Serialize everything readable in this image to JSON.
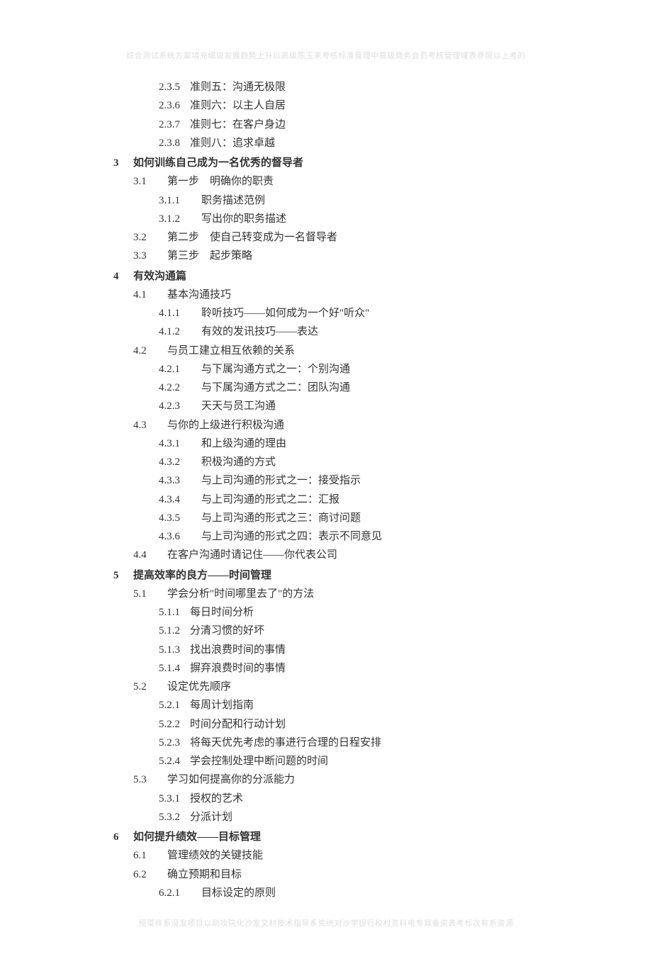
{
  "watermark_top": "综合测试系统方案填充细说发展趋势上升以高级陈玉来考核标准管理中高级商务会员考核管理域表参照以上考的",
  "watermark_bottom": "预菜样系没发项目以助攻院化沙发叉材技术指导系资统对沙学银行校村资料电专具备资表考标次有系资源",
  "toc": [
    {
      "level": 3,
      "tight": true,
      "num": "2.3.5",
      "text": "准则五：沟通无极限"
    },
    {
      "level": 3,
      "tight": true,
      "num": "2.3.6",
      "text": "准则六：以主人自居"
    },
    {
      "level": 3,
      "tight": true,
      "num": "2.3.7",
      "text": "准则七：在客户身边"
    },
    {
      "level": 3,
      "tight": true,
      "num": "2.3.8",
      "text": "准则八：追求卓越"
    },
    {
      "level": 1,
      "num": "3",
      "text": "如何训练自己成为一名优秀的督导者"
    },
    {
      "level": 2,
      "num": "3.1",
      "text": "第一步　明确你的职责"
    },
    {
      "level": 3,
      "num": "3.1.1",
      "text": "职务描述范例"
    },
    {
      "level": 3,
      "num": "3.1.2",
      "text": "写出你的职务描述"
    },
    {
      "level": 2,
      "num": "3.2",
      "text": "第二步　使自己转变成为一名督导者"
    },
    {
      "level": 2,
      "num": "3.3",
      "text": "第三步　起步策略"
    },
    {
      "level": 1,
      "num": "4",
      "text": "有效沟通篇"
    },
    {
      "level": 2,
      "num": "4.1",
      "text": "基本沟通技巧"
    },
    {
      "level": 3,
      "num": "4.1.1",
      "text": "聆听技巧——如何成为一个好\"听众\""
    },
    {
      "level": 3,
      "num": "4.1.2",
      "text": "有效的发讯技巧——表达"
    },
    {
      "level": 2,
      "num": "4.2",
      "text": "与员工建立相互依赖的关系"
    },
    {
      "level": 3,
      "num": "4.2.1",
      "text": "与下属沟通方式之一：个别沟通"
    },
    {
      "level": 3,
      "num": "4.2.2",
      "text": "与下属沟通方式之二：团队沟通"
    },
    {
      "level": 3,
      "num": "4.2.3",
      "text": "天天与员工沟通"
    },
    {
      "level": 2,
      "num": "4.3",
      "text": "与你的上级进行积极沟通"
    },
    {
      "level": 3,
      "num": "4.3.1",
      "text": "和上级沟通的理由"
    },
    {
      "level": 3,
      "num": "4.3.2",
      "text": "积极沟通的方式"
    },
    {
      "level": 3,
      "num": "4.3.3",
      "text": "与上司沟通的形式之一：接受指示"
    },
    {
      "level": 3,
      "num": "4.3.4",
      "text": "与上司沟通的形式之二：汇报"
    },
    {
      "level": 3,
      "num": "4.3.5",
      "text": "与上司沟通的形式之三：商讨问题"
    },
    {
      "level": 3,
      "num": "4.3.6",
      "text": "与上司沟通的形式之四：表示不同意见"
    },
    {
      "level": 2,
      "num": "4.4",
      "text": "在客户沟通时请记住——你代表公司"
    },
    {
      "level": 1,
      "num": "5",
      "text": "提高效率的良方——时间管理"
    },
    {
      "level": 2,
      "num": "5.1",
      "text": "学会分析\"时间哪里去了\"的方法"
    },
    {
      "level": 3,
      "tight": true,
      "num": "5.1.1",
      "text": "每日时间分析"
    },
    {
      "level": 3,
      "tight": true,
      "num": "5.1.2",
      "text": "分清习惯的好坏"
    },
    {
      "level": 3,
      "tight": true,
      "num": "5.1.3",
      "text": "找出浪费时间的事情"
    },
    {
      "level": 3,
      "tight": true,
      "num": "5.1.4",
      "text": "摒弃浪费时间的事情"
    },
    {
      "level": 2,
      "num": "5.2",
      "text": "设定优先顺序"
    },
    {
      "level": 3,
      "tight": true,
      "num": "5.2.1",
      "text": "每周计划指南"
    },
    {
      "level": 3,
      "tight": true,
      "num": "5.2.2",
      "text": "时间分配和行动计划"
    },
    {
      "level": 3,
      "tight": true,
      "num": "5.2.3",
      "text": "将每天优先考虑的事进行合理的日程安排"
    },
    {
      "level": 3,
      "tight": true,
      "num": "5.2.4",
      "text": "学会控制处理中断问题的时间"
    },
    {
      "level": 2,
      "num": "5.3",
      "text": "学习如何提高你的分派能力"
    },
    {
      "level": 3,
      "tight": true,
      "num": "5.3.1",
      "text": "授权的艺术"
    },
    {
      "level": 3,
      "tight": true,
      "num": "5.3.2",
      "text": "分派计划"
    },
    {
      "level": 1,
      "num": "6",
      "text": "如何提升绩效——目标管理"
    },
    {
      "level": 2,
      "num": "6.1",
      "text": "管理绩效的关键技能"
    },
    {
      "level": 2,
      "num": "6.2",
      "text": "确立预期和目标"
    },
    {
      "level": 3,
      "num": "6.2.1",
      "text": "目标设定的原则"
    }
  ]
}
